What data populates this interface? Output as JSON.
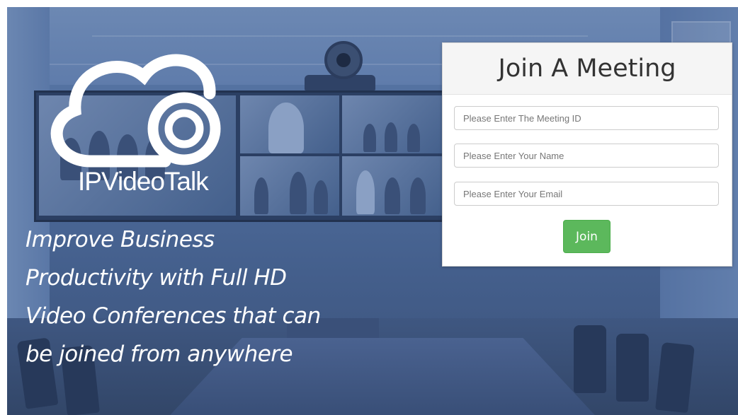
{
  "brand": {
    "logo_text": "IPVideoTalk"
  },
  "tagline": {
    "text": "Improve Business Productivity with Full HD Video Conferences that can be joined from anywhere"
  },
  "join_form": {
    "title": "Join A Meeting",
    "meeting_id_placeholder": "Please Enter The Meeting ID",
    "name_placeholder": "Please Enter Your Name",
    "email_placeholder": "Please Enter Your Email",
    "submit_label": "Join"
  },
  "colors": {
    "overlay": "#4f6d9d",
    "join_button": "#5cb85c",
    "panel_header": "#f5f5f5"
  }
}
